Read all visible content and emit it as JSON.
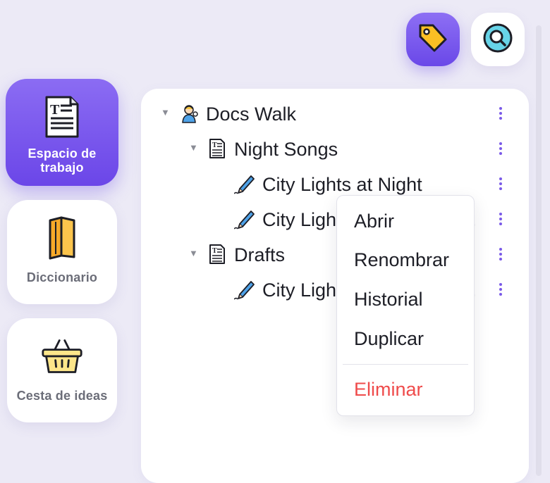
{
  "sidebar": {
    "items": [
      {
        "label": "Espacio de trabajo",
        "icon": "document-icon",
        "active": true
      },
      {
        "label": "Diccionario",
        "icon": "book-icon",
        "active": false
      },
      {
        "label": "Cesta de ideas",
        "icon": "basket-icon",
        "active": false
      }
    ]
  },
  "toolbar": {
    "tag_icon": "tag-icon",
    "search_icon": "search-icon"
  },
  "tree": {
    "rows": [
      {
        "label": "Docs Walk",
        "icon": "person-icon",
        "expanded": true,
        "level": 0
      },
      {
        "label": "Night Songs",
        "icon": "document-icon",
        "expanded": true,
        "level": 1
      },
      {
        "label": "City Lights at Night",
        "icon": "pen-icon",
        "level": 2
      },
      {
        "label": "City Lights",
        "icon": "pen-icon",
        "level": 2,
        "truncated": true
      },
      {
        "label": "Drafts",
        "icon": "document-icon",
        "expanded": true,
        "level": 1
      },
      {
        "label": "City Lights",
        "icon": "pen-icon",
        "level": 2,
        "truncated": true
      }
    ],
    "ellipsis": "."
  },
  "context_menu": {
    "items": [
      "Abrir",
      "Renombrar",
      "Historial",
      "Duplicar"
    ],
    "danger_item": "Eliminar"
  },
  "colors": {
    "accent": "#6b46e8",
    "danger": "#ef4b4b",
    "background": "#eceaf6"
  }
}
